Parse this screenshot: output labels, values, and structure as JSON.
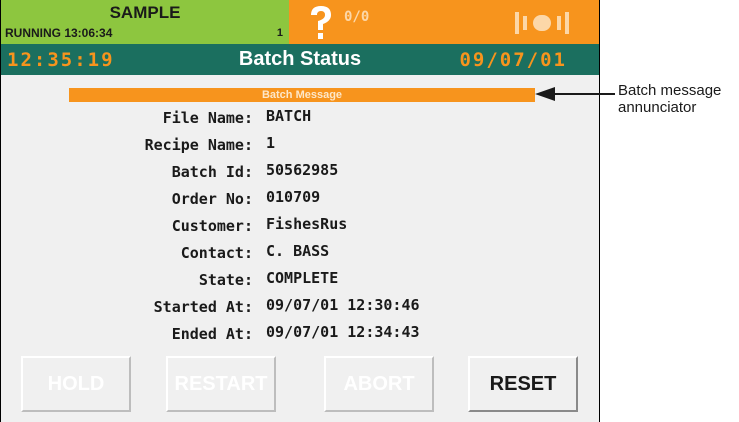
{
  "status_bar": {
    "group_name": "SAMPLE",
    "run_state": "RUNNING 13:06:34",
    "unit_number": "1",
    "io_status": "0/0",
    "alarm_icon": "question-mark-icon",
    "signal_icon": "network-status-icon",
    "colors": {
      "running": "#8dc63f",
      "alarm": "#f7941d"
    }
  },
  "header": {
    "time": "12:35:19",
    "title": "Batch Status",
    "date": "09/07/01",
    "colors": {
      "background": "#1b6f5f",
      "accent": "#f7941d"
    }
  },
  "annunciator": {
    "label": "Batch Message"
  },
  "fields": [
    {
      "label": "File Name:",
      "value": "BATCH"
    },
    {
      "label": "Recipe Name:",
      "value": "1"
    },
    {
      "label": "Batch Id:",
      "value": "50562985"
    },
    {
      "label": "Order No:",
      "value": "010709"
    },
    {
      "label": "Customer:",
      "value": "FishesRus"
    },
    {
      "label": "Contact:",
      "value": "C. BASS"
    },
    {
      "label": "State:",
      "value": "COMPLETE"
    },
    {
      "label": "Started At:",
      "value": "09/07/01 12:30:46"
    },
    {
      "label": "Ended At:",
      "value": "09/07/01 12:34:43"
    }
  ],
  "buttons": {
    "hold": {
      "label": "HOLD",
      "enabled": false
    },
    "restart": {
      "label": "RESTART",
      "enabled": false
    },
    "abort": {
      "label": "ABORT",
      "enabled": false
    },
    "reset": {
      "label": "RESET",
      "enabled": true
    }
  },
  "callout": {
    "line1": "Batch message",
    "line2": "annunciator"
  }
}
